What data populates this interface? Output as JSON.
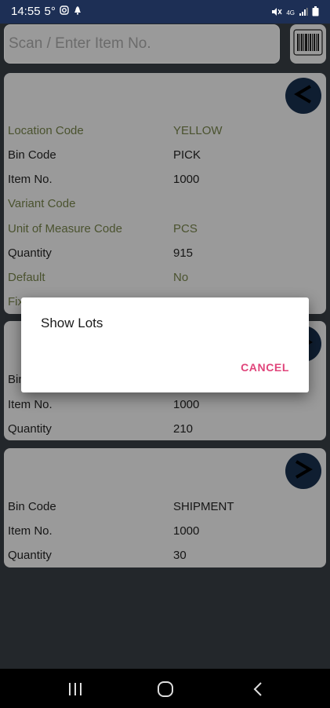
{
  "status_bar": {
    "time": "14:55",
    "temperature": "5°",
    "network": "4G"
  },
  "scan": {
    "placeholder": "Scan / Enter Item No."
  },
  "cards": [
    {
      "rows": [
        {
          "label": "Location Code",
          "value": "YELLOW",
          "muted": true
        },
        {
          "label": "Bin Code",
          "value": "PICK",
          "muted": false
        },
        {
          "label": "Item No.",
          "value": "1000",
          "muted": false
        },
        {
          "label": "Variant Code",
          "value": "",
          "muted": true
        },
        {
          "label": "Unit of Measure Code",
          "value": "PCS",
          "muted": true
        },
        {
          "label": "Quantity",
          "value": "915",
          "muted": false
        },
        {
          "label": "Default",
          "value": "No",
          "muted": true
        },
        {
          "label": "Fix",
          "value": "",
          "muted": true
        }
      ],
      "nav_icon": "chevron-left-icon"
    },
    {
      "rows": [
        {
          "label": "Bin Code",
          "value": "",
          "muted": false
        },
        {
          "label": "Item No.",
          "value": "1000",
          "muted": false
        },
        {
          "label": "Quantity",
          "value": "210",
          "muted": false
        }
      ],
      "nav_icon": "chevron-right-icon"
    },
    {
      "rows": [
        {
          "label": "Bin Code",
          "value": "SHIPMENT",
          "muted": false
        },
        {
          "label": "Item No.",
          "value": "1000",
          "muted": false
        },
        {
          "label": "Quantity",
          "value": "30",
          "muted": false
        }
      ],
      "nav_icon": "chevron-right-icon"
    }
  ],
  "dialog": {
    "title": "Show Lots",
    "cancel_label": "CANCEL"
  },
  "colors": {
    "status_bar": "#1d2f55",
    "card": "#c6c6c6",
    "accent": "#e0457b",
    "nav_circle": "#14273f",
    "muted_label": "#5f6a3c"
  }
}
